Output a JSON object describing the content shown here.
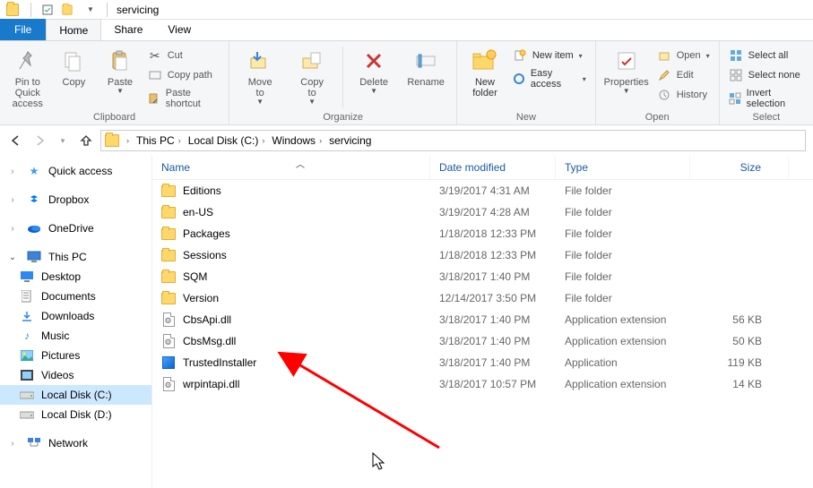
{
  "title": "servicing",
  "tabs": {
    "file": "File",
    "home": "Home",
    "share": "Share",
    "view": "View"
  },
  "ribbon": {
    "clipboard": {
      "label": "Clipboard",
      "pin": "Pin to Quick\naccess",
      "copy": "Copy",
      "paste": "Paste",
      "cut": "Cut",
      "copy_path": "Copy path",
      "paste_shortcut": "Paste shortcut"
    },
    "organize": {
      "label": "Organize",
      "move_to": "Move\nto",
      "copy_to": "Copy\nto",
      "delete": "Delete",
      "rename": "Rename"
    },
    "new": {
      "label": "New",
      "new_folder": "New\nfolder",
      "new_item": "New item",
      "easy_access": "Easy access"
    },
    "open": {
      "label": "Open",
      "properties": "Properties",
      "open": "Open",
      "edit": "Edit",
      "history": "History"
    },
    "select": {
      "label": "Select",
      "select_all": "Select all",
      "select_none": "Select none",
      "invert": "Invert selection"
    }
  },
  "breadcrumb": [
    "This PC",
    "Local Disk (C:)",
    "Windows",
    "servicing"
  ],
  "tree": {
    "quick_access": "Quick access",
    "dropbox": "Dropbox",
    "onedrive": "OneDrive",
    "this_pc": "This PC",
    "desktop": "Desktop",
    "documents": "Documents",
    "downloads": "Downloads",
    "music": "Music",
    "pictures": "Pictures",
    "videos": "Videos",
    "local_c": "Local Disk (C:)",
    "local_d": "Local Disk (D:)",
    "network": "Network"
  },
  "columns": {
    "name": "Name",
    "date": "Date modified",
    "type": "Type",
    "size": "Size"
  },
  "rows": [
    {
      "name": "Editions",
      "date": "3/19/2017 4:31 AM",
      "type": "File folder",
      "size": "",
      "kind": "folder"
    },
    {
      "name": "en-US",
      "date": "3/19/2017 4:28 AM",
      "type": "File folder",
      "size": "",
      "kind": "folder"
    },
    {
      "name": "Packages",
      "date": "1/18/2018 12:33 PM",
      "type": "File folder",
      "size": "",
      "kind": "folder"
    },
    {
      "name": "Sessions",
      "date": "1/18/2018 12:33 PM",
      "type": "File folder",
      "size": "",
      "kind": "folder"
    },
    {
      "name": "SQM",
      "date": "3/18/2017 1:40 PM",
      "type": "File folder",
      "size": "",
      "kind": "folder"
    },
    {
      "name": "Version",
      "date": "12/14/2017 3:50 PM",
      "type": "File folder",
      "size": "",
      "kind": "folder"
    },
    {
      "name": "CbsApi.dll",
      "date": "3/18/2017 1:40 PM",
      "type": "Application extension",
      "size": "56 KB",
      "kind": "dll"
    },
    {
      "name": "CbsMsg.dll",
      "date": "3/18/2017 1:40 PM",
      "type": "Application extension",
      "size": "50 KB",
      "kind": "dll"
    },
    {
      "name": "TrustedInstaller",
      "date": "3/18/2017 1:40 PM",
      "type": "Application",
      "size": "119 KB",
      "kind": "app"
    },
    {
      "name": "wrpintapi.dll",
      "date": "3/18/2017 10:57 PM",
      "type": "Application extension",
      "size": "14 KB",
      "kind": "dll"
    }
  ],
  "annotation": {
    "arrow_target": "TrustedInstaller"
  }
}
